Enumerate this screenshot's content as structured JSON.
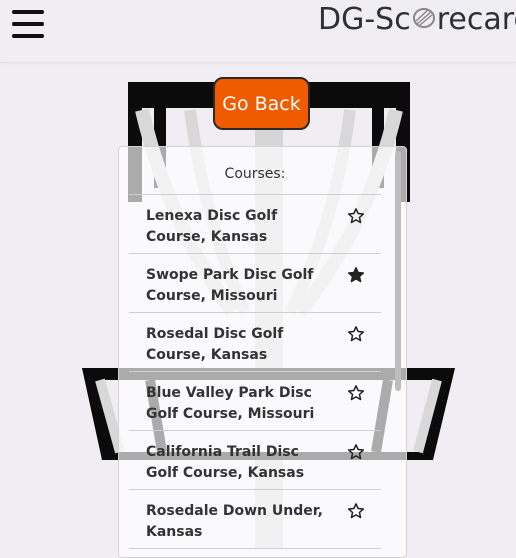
{
  "header": {
    "logo_text_left": "DG-Sc",
    "logo_text_right": "recard"
  },
  "go_back_label": "Go Back",
  "courses": {
    "heading": "Courses:",
    "items": [
      {
        "name": "Lenexa Disc Golf Course, Kansas",
        "favorite": false
      },
      {
        "name": "Swope Park Disc Golf Course, Missouri",
        "favorite": true
      },
      {
        "name": "Rosedal Disc Golf Course, Kansas",
        "favorite": false
      },
      {
        "name": "Blue Valley Park Disc Golf Course, Missouri",
        "favorite": false
      },
      {
        "name": "California Trail Disc Golf Course, Kansas",
        "favorite": false
      },
      {
        "name": "Rosedale Down Under, Kansas",
        "favorite": false
      }
    ]
  },
  "colors": {
    "accent": "#f15b00",
    "background": "#f1eef3"
  }
}
